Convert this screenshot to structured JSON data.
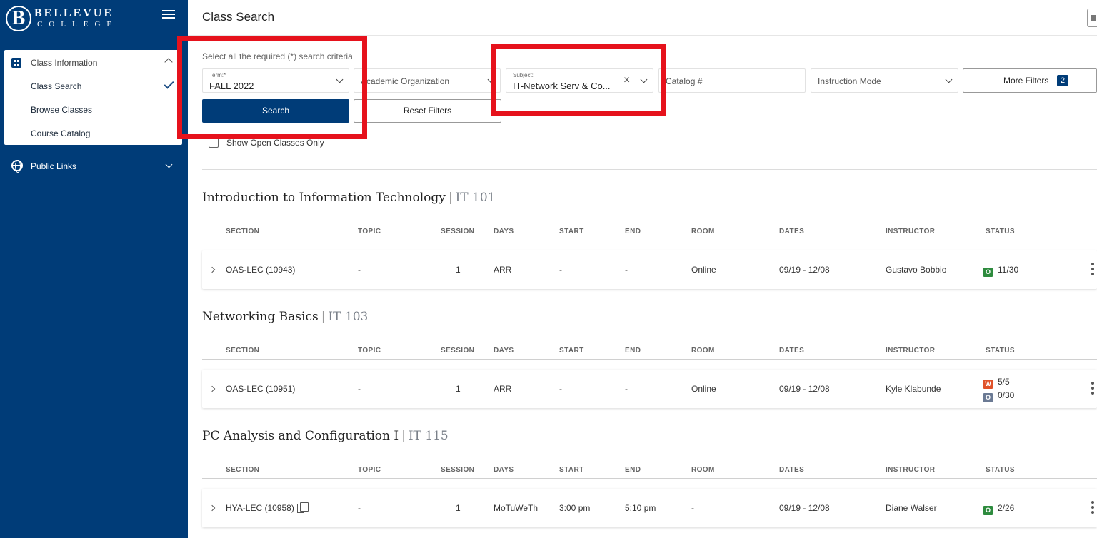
{
  "brand": {
    "initial": "B",
    "name_top": "BELLEVUE",
    "name_bottom": "COLLEGE"
  },
  "sidebar": {
    "group_label": "Class Information",
    "items": [
      {
        "label": "Class Search",
        "selected": true
      },
      {
        "label": "Browse Classes"
      },
      {
        "label": "Course Catalog"
      }
    ],
    "public_links_label": "Public Links"
  },
  "page": {
    "title": "Class Search",
    "criteria_hint": "Select all the required (*) search criteria"
  },
  "filters": {
    "term": {
      "label": "Term:*",
      "value": "FALL 2022"
    },
    "academic_org": {
      "placeholder": "Academic Organization"
    },
    "subject": {
      "label": "Subject:",
      "value": "IT-Network Serv & Co..."
    },
    "catalog": {
      "placeholder": "Catalog #"
    },
    "instruction_mode": {
      "placeholder": "Instruction Mode"
    },
    "more_filters_label": "More Filters",
    "more_filters_count": "2",
    "search_label": "Search",
    "reset_label": "Reset Filters",
    "open_only_label": "Show Open Classes Only"
  },
  "columns": [
    "SECTION",
    "TOPIC",
    "SESSION",
    "DAYS",
    "START",
    "END",
    "ROOM",
    "DATES",
    "INSTRUCTOR",
    "STATUS"
  ],
  "courses": [
    {
      "title": "Introduction to Information Technology",
      "code": "IT 101",
      "rows": [
        {
          "section": "OAS-LEC (10943)",
          "topic": "-",
          "session": "1",
          "days": "ARR",
          "start": "-",
          "end": "-",
          "room": "Online",
          "dates": "09/19 - 12/08",
          "instructor": "Gustavo Bobbio",
          "status": [
            {
              "badge": "O",
              "color": "#2e8b3e",
              "text": "11/30"
            }
          ]
        }
      ]
    },
    {
      "title": "Networking Basics",
      "code": "IT 103",
      "rows": [
        {
          "section": "OAS-LEC (10951)",
          "topic": "-",
          "session": "1",
          "days": "ARR",
          "start": "-",
          "end": "-",
          "room": "Online",
          "dates": "09/19 - 12/08",
          "instructor": "Kyle Klabunde",
          "status": [
            {
              "badge": "W",
              "color": "#e0522a",
              "text": "5/5"
            },
            {
              "badge": "O",
              "color": "#6b7a94",
              "text": "0/30"
            }
          ]
        }
      ]
    },
    {
      "title": "PC Analysis and Configuration I",
      "code": "IT 115",
      "rows": [
        {
          "section": "HYA-LEC (10958)",
          "topic": "-",
          "session": "1",
          "days": "MoTuWeTh",
          "start": "3:00 pm",
          "end": "5:10 pm",
          "room": "-",
          "dates": "09/19 - 12/08",
          "instructor": "Diane Walser",
          "status": [
            {
              "badge": "O",
              "color": "#2e8b3e",
              "text": "2/26"
            }
          ]
        }
      ]
    }
  ],
  "colors": {
    "brand": "#003c78",
    "annotation": "#e6121c",
    "open": "#2e8b3e",
    "waitlist": "#e0522a",
    "closed": "#6b7a94"
  }
}
